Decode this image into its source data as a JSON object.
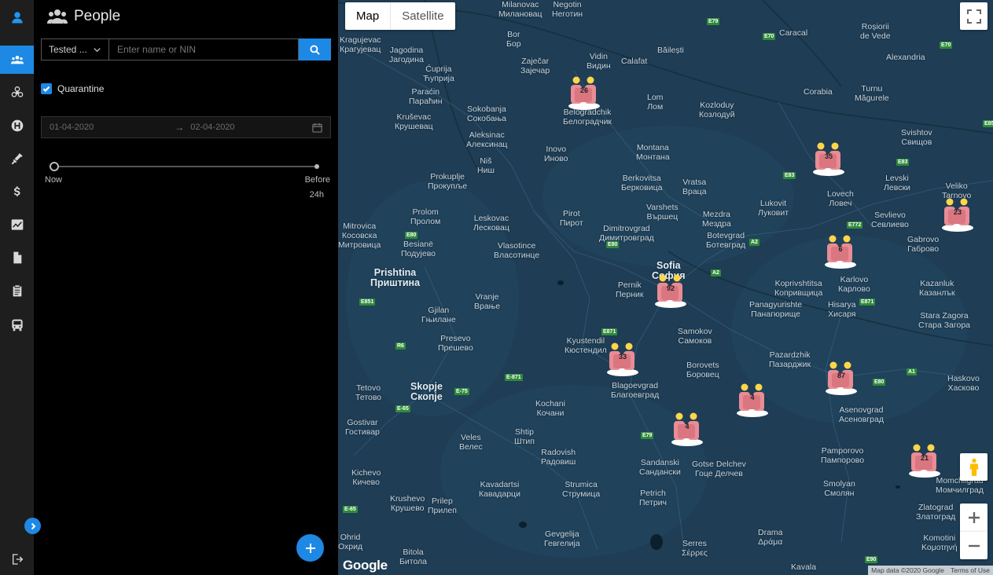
{
  "rail": {
    "items": [
      {
        "icon": "app-logo-icon"
      },
      {
        "icon": "people-icon"
      },
      {
        "icon": "biohazard-icon"
      },
      {
        "icon": "hospital-icon"
      },
      {
        "icon": "syringe-icon"
      },
      {
        "icon": "dollar-icon"
      },
      {
        "icon": "chart-icon"
      },
      {
        "icon": "document-icon"
      },
      {
        "icon": "clipboard-icon"
      },
      {
        "icon": "bus-icon"
      },
      {
        "icon": "logout-icon"
      }
    ],
    "active": "people-icon"
  },
  "panel": {
    "title": "People",
    "filter": {
      "selected": "Tested ...",
      "placeholder": "Enter name or NIN"
    },
    "quarantine": {
      "label": "Quarantine",
      "checked": true
    },
    "date_range": {
      "start": "01-04-2020",
      "arrow": "→",
      "end": "02-04-2020"
    },
    "slider": {
      "left_label": "Now",
      "right_label": "Before",
      "right_sub": "24h",
      "value": 0
    }
  },
  "map": {
    "type_buttons": [
      "Map",
      "Satellite"
    ],
    "active_type": "Map",
    "logo": "Google",
    "attribution": [
      "Map data ©2020 Google",
      "Terms of Use"
    ],
    "labels": [
      {
        "t": "Milanovac\nМилановац"
      },
      {
        "t": "Negotin\nНеготин"
      },
      {
        "t": "Caracal"
      },
      {
        "t": "Roșiorii\nde Vede"
      },
      {
        "t": "Kragujevac\nКрагујевац"
      },
      {
        "t": "Jagodina\nЈагодина"
      },
      {
        "t": "Bor\nБор"
      },
      {
        "t": "Zaječar\nЗајечар"
      },
      {
        "t": "Vidin\nВидин"
      },
      {
        "t": "Calafat"
      },
      {
        "t": "Băilești"
      },
      {
        "t": "Alexandria"
      },
      {
        "t": "Ćuprija\nЋуприја"
      },
      {
        "t": "Paraćin\nПараћин"
      },
      {
        "t": "Kruševac\nКрушевац"
      },
      {
        "t": "Sokobanja\nСокобања"
      },
      {
        "t": "Aleksinac\nАлексинац"
      },
      {
        "t": "Lom\nЛом"
      },
      {
        "t": "Kozloduy\nКозлодуй"
      },
      {
        "t": "Corabia"
      },
      {
        "t": "Turnu\nMăgurele"
      },
      {
        "t": "Svishtov\nСвищов"
      },
      {
        "t": "Belogradchik\nБелоградчик"
      },
      {
        "t": "Inovo\nИново"
      },
      {
        "t": "Montana\nМонтана"
      },
      {
        "t": "Niš\nНиш"
      },
      {
        "t": "Prokuplje\nПрокупље"
      },
      {
        "t": "Berkovitsa\nБерковица"
      },
      {
        "t": "Vratsa\nВраца"
      },
      {
        "t": "Lovech\nЛовеч"
      },
      {
        "t": "Levski\nЛевски"
      },
      {
        "t": "Veliko\nTarnovo"
      },
      {
        "t": "Prolom\nПролом"
      },
      {
        "t": "Leskovac\nЛесковац"
      },
      {
        "t": "Pirot\nПирот"
      },
      {
        "t": "Dimitrovgrad\nДимитровград"
      },
      {
        "t": "Varshets\nВършец"
      },
      {
        "t": "Mezdra\nМездра"
      },
      {
        "t": "Lukovit\nЛуковит"
      },
      {
        "t": "Sevlievo\nСевлиево"
      },
      {
        "t": "Gabrovo\nГаброво"
      },
      {
        "t": "Mitrovica\nКосовска\nМитровица"
      },
      {
        "t": "Besianë\nПодујево"
      },
      {
        "t": "Vlasotince\nВласотинце"
      },
      {
        "t": "Botevgrad\nБотевград"
      },
      {
        "t": "Sofia\nСофия"
      },
      {
        "t": "Karlovo\nКарлово"
      },
      {
        "t": "Kazanluk\nКазанлък"
      },
      {
        "t": "Prishtina\nПриштина"
      },
      {
        "t": "Pernik\nПерник"
      },
      {
        "t": "Koprivshtitsa\nКопривщица"
      },
      {
        "t": "Vranje\nВрање"
      },
      {
        "t": "Gjilan\nГњилане"
      },
      {
        "t": "Panagyurishte\nПанагюрище"
      },
      {
        "t": "Hisarya\nХисаря"
      },
      {
        "t": "Stara Zagora\nСтара Загора"
      },
      {
        "t": "Samokov\nСамоков"
      },
      {
        "t": "Kyustendil\nКюстендил"
      },
      {
        "t": "Presevo\nПрешево"
      },
      {
        "t": "Pazardzhik\nПазарджик"
      },
      {
        "t": "Borovets\nБоровец"
      },
      {
        "t": "Tetovo\nТетово"
      },
      {
        "t": "Skopje\nСкопје"
      },
      {
        "t": "Blagoevgrad\nБлагоевград"
      },
      {
        "t": "Haskovo\nХасково"
      },
      {
        "t": "Kochani\nКочани"
      },
      {
        "t": "Asenovgrad\nАсеновград"
      },
      {
        "t": "Gostivar\nГостивар"
      },
      {
        "t": "Veles\nВелес"
      },
      {
        "t": "Shtip\nШтип"
      },
      {
        "t": "Radovish\nРадовиш"
      },
      {
        "t": "Sandanski\nСандански"
      },
      {
        "t": "Gotse Delchev\nГоце Делчев"
      },
      {
        "t": "Pamporovo\nПампорово"
      },
      {
        "t": "Kichevo\nКичево"
      },
      {
        "t": "Kavadartsi\nКавадарци"
      },
      {
        "t": "Strumica\nСтрумица"
      },
      {
        "t": "Smolyan\nСмолян"
      },
      {
        "t": "Krushevo\nКрушево"
      },
      {
        "t": "Prilep\nПрилеп"
      },
      {
        "t": "Petrich\nПетрич"
      },
      {
        "t": "Zlatograd\nЗлатоград"
      },
      {
        "t": "Gevgelija\nГевгелија"
      },
      {
        "t": "Drama\nΔράμα"
      },
      {
        "t": "Komotini\nΚομοτηνή"
      },
      {
        "t": "Ohrid\nОхрид"
      },
      {
        "t": "Bitola\nБитола"
      },
      {
        "t": "Serres\nΣέρρες"
      },
      {
        "t": "Kavala"
      },
      {
        "t": "Momchilgrad\nМомчилград"
      }
    ],
    "roads": [
      "E79",
      "E70",
      "E70",
      "E83",
      "E83",
      "E772",
      "E80",
      "E80",
      "A2",
      "A2",
      "E851",
      "E871",
      "E79",
      "R6",
      "E-871",
      "E-75",
      "E-65",
      "E-65",
      "E871",
      "E80",
      "A1",
      "E85",
      "E90"
    ],
    "clusters": [
      {
        "count": "26"
      },
      {
        "count": "35"
      },
      {
        "count": "23"
      },
      {
        "count": "6"
      },
      {
        "count": "92"
      },
      {
        "count": "33"
      },
      {
        "count": "87"
      },
      {
        "count": "4"
      },
      {
        "count": "4"
      },
      {
        "count": "21"
      }
    ],
    "controls": {
      "fullscreen": "fullscreen-icon",
      "streetview": "pegman-icon",
      "zoom_in": "+",
      "zoom_out": "−"
    }
  }
}
